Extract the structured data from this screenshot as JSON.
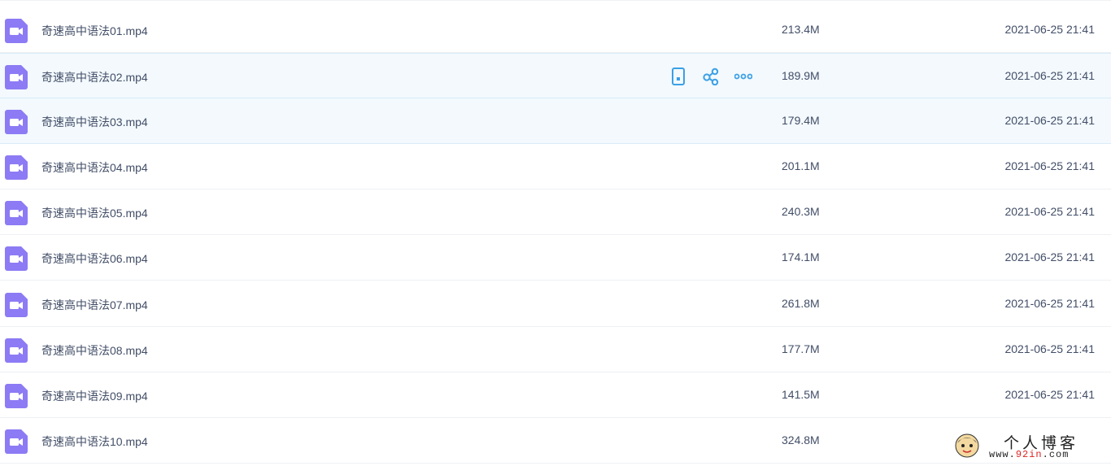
{
  "theme": {
    "icon_color": "#8c7bf4",
    "action_color": "#3ba0e6",
    "text_color": "#424e67"
  },
  "files": [
    {
      "name": "奇速高中语法01.mp4",
      "size": "213.4M",
      "date": "2021-06-25 21:41"
    },
    {
      "name": "奇速高中语法02.mp4",
      "size": "189.9M",
      "date": "2021-06-25 21:41"
    },
    {
      "name": "奇速高中语法03.mp4",
      "size": "179.4M",
      "date": "2021-06-25 21:41"
    },
    {
      "name": "奇速高中语法04.mp4",
      "size": "201.1M",
      "date": "2021-06-25 21:41"
    },
    {
      "name": "奇速高中语法05.mp4",
      "size": "240.3M",
      "date": "2021-06-25 21:41"
    },
    {
      "name": "奇速高中语法06.mp4",
      "size": "174.1M",
      "date": "2021-06-25 21:41"
    },
    {
      "name": "奇速高中语法07.mp4",
      "size": "261.8M",
      "date": "2021-06-25 21:41"
    },
    {
      "name": "奇速高中语法08.mp4",
      "size": "177.7M",
      "date": "2021-06-25 21:41"
    },
    {
      "name": "奇速高中语法09.mp4",
      "size": "141.5M",
      "date": "2021-06-25 21:41"
    },
    {
      "name": "奇速高中语法10.mp4",
      "size": "324.8M",
      "date": ""
    }
  ],
  "hover_actions": {
    "icons": [
      "phone-icon",
      "share-icon",
      "more-icon"
    ]
  },
  "watermark": {
    "title": "个人博客",
    "url_prefix": "www.",
    "url_highlight": "92in",
    "url_suffix": ".com"
  }
}
